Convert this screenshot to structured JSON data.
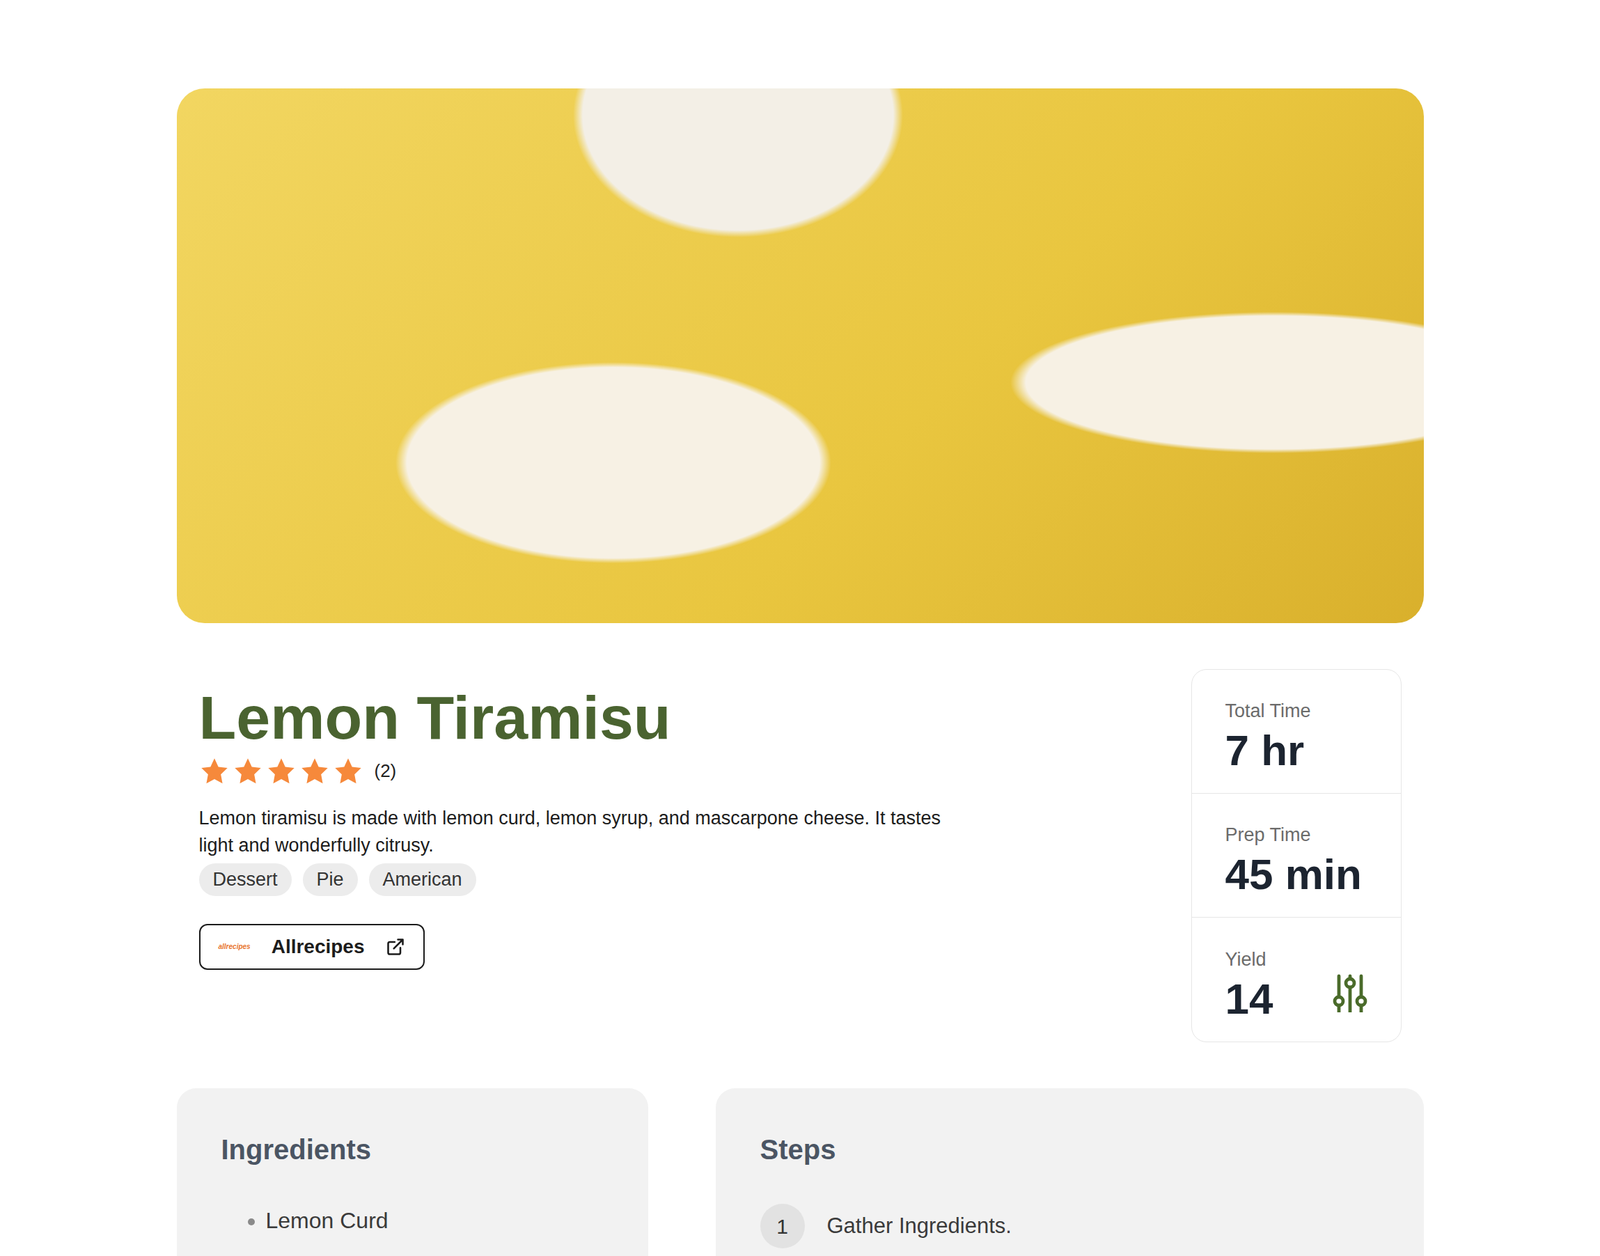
{
  "recipe": {
    "title": "Lemon Tiramisu",
    "rating": {
      "stars": 5,
      "count": "(2)"
    },
    "description": "Lemon tiramisu is made with lemon curd, lemon syrup, and mascarpone cheese. It tastes light and wonderfully citrusy.",
    "tags": [
      "Dessert",
      "Pie",
      "American"
    ],
    "source": {
      "logo": "allrecipes",
      "label": "Allrecipes"
    }
  },
  "stats": [
    {
      "label": "Total Time",
      "value": "7 hr",
      "kind": "plain"
    },
    {
      "label": "Prep Time",
      "value": "45 min",
      "kind": "plain"
    },
    {
      "label": "Yield",
      "value": "14",
      "kind": "adjustable"
    }
  ],
  "ingredients": {
    "heading": "Ingredients",
    "items": [
      "Lemon Curd"
    ]
  },
  "steps": {
    "heading": "Steps",
    "items": [
      {
        "number": "1",
        "text": "Gather Ingredients."
      }
    ]
  }
}
